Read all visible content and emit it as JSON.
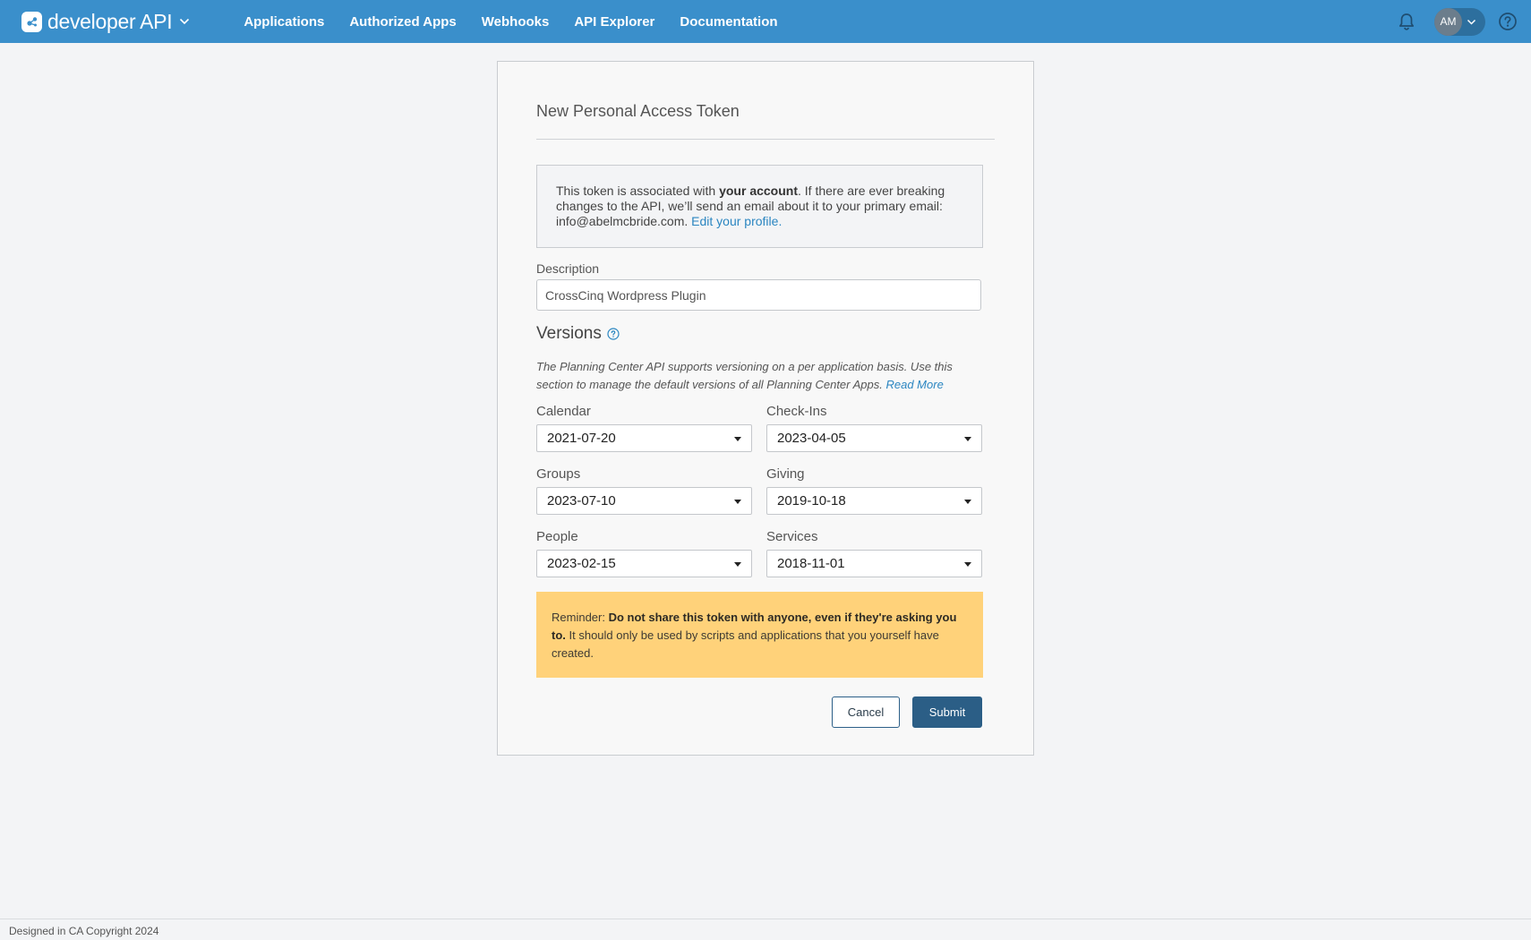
{
  "header": {
    "brand": "developer API",
    "nav": [
      "Applications",
      "Authorized Apps",
      "Webhooks",
      "API Explorer",
      "Documentation"
    ],
    "avatar_initials": "AM",
    "accent_color": "#3a8fcb",
    "icons": [
      "developer-logo-icon",
      "chevron-down-icon",
      "bell-icon",
      "help-circle-icon"
    ]
  },
  "form": {
    "title": "New Personal Access Token",
    "info": {
      "pre": "This token is associated with ",
      "bold": "your account",
      "post": ". If there are ever breaking changes to the API, we’ll send an email about it to your primary email: info@abelmcbride.com. ",
      "link": "Edit your profile."
    },
    "description": {
      "label": "Description",
      "value": "CrossCinq Wordpress Plugin"
    },
    "versions": {
      "title": "Versions",
      "desc": "The Planning Center API supports versioning on a per application basis. Use this section to manage the default versions of all Planning Center Apps. ",
      "link": "Read More",
      "fields": [
        {
          "label": "Calendar",
          "value": "2021-07-20"
        },
        {
          "label": "Check-Ins",
          "value": "2023-04-05"
        },
        {
          "label": "Groups",
          "value": "2023-07-10"
        },
        {
          "label": "Giving",
          "value": "2019-10-18"
        },
        {
          "label": "People",
          "value": "2023-02-15"
        },
        {
          "label": "Services",
          "value": "2018-11-01"
        }
      ]
    },
    "reminder": {
      "pre": "Reminder: ",
      "bold": "Do not share this token with anyone, even if they're asking you to.",
      "post": " It should only be used by scripts and applications that you yourself have created."
    },
    "cancel_label": "Cancel",
    "submit_label": "Submit"
  },
  "footer": {
    "text": "Designed in CA Copyright 2024"
  }
}
